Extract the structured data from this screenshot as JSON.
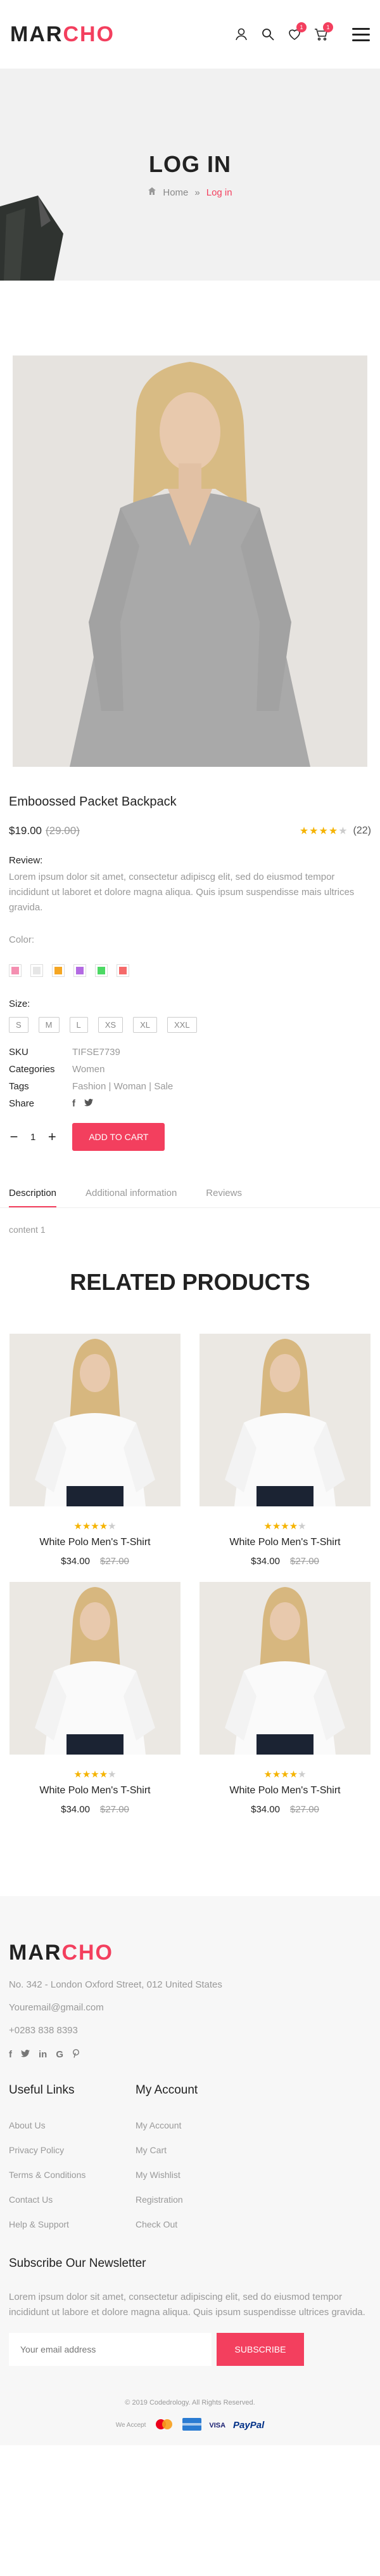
{
  "header": {
    "logo_dark": "MAR",
    "logo_red": "CHO",
    "wishlist_count": "1",
    "cart_count": "1"
  },
  "banner": {
    "title": "LOG IN",
    "crumb_home": "Home",
    "crumb_sep": "»",
    "crumb_active": "Log in"
  },
  "product": {
    "title": "Emboossed Packet Backpack",
    "price": "$19.00",
    "old_price": "(29.00)",
    "rating": 4,
    "rating_max": 5,
    "reviews": "(22)",
    "review_label": "Review:",
    "review_text": "Lorem ipsum dolor sit amet, consectetur adipiscg elit, sed do eiusmod tempor incididunt ut laboret et dolore magna aliqua. Quis ipsum suspendisse mais ultrices gravida.",
    "color_label": "Color:",
    "colors": [
      "#f48fb1",
      "#e6e6e6",
      "#f5a623",
      "#b36ae2",
      "#4cd964",
      "#f56a6a"
    ],
    "size_label": "Size:",
    "sizes": [
      "S",
      "M",
      "L",
      "XS",
      "XL",
      "XXL"
    ],
    "sku_label": "SKU",
    "sku_value": "TIFSE7739",
    "cat_label": "Categories",
    "cat_value": "Women",
    "tags_label": "Tags",
    "tags_value": "Fashion | Woman | Sale",
    "share_label": "Share",
    "qty_minus": "−",
    "qty_value": "1",
    "qty_plus": "+",
    "add_to_cart": "ADD TO CART"
  },
  "tabs": {
    "description": "Description",
    "additional": "Additional information",
    "reviews": "Reviews",
    "content": "content 1"
  },
  "related": {
    "title": "RELATED PRODUCTS",
    "items": [
      {
        "name": "White Polo Men's T-Shirt",
        "price": "$34.00",
        "old": "$27.00",
        "rating": 4
      },
      {
        "name": "White Polo Men's T-Shirt",
        "price": "$34.00",
        "old": "$27.00",
        "rating": 4
      },
      {
        "name": "White Polo Men's T-Shirt",
        "price": "$34.00",
        "old": "$27.00",
        "rating": 4
      },
      {
        "name": "White Polo Men's T-Shirt",
        "price": "$34.00",
        "old": "$27.00",
        "rating": 4
      }
    ]
  },
  "footer": {
    "logo_dark": "MAR",
    "logo_red": "CHO",
    "address": "No. 342 - London Oxford Street, 012 United States",
    "email": "Youremail@gmail.com",
    "phone": "+0283 838 8393",
    "useful_title": "Useful Links",
    "useful": [
      "About Us",
      "Privacy Policy",
      "Terms & Conditions",
      "Contact Us",
      "Help & Support"
    ],
    "account_title": "My Account",
    "account": [
      "My Account",
      "My Cart",
      "My Wishlist",
      "Registration",
      "Check Out"
    ],
    "newsletter_title": "Subscribe Our Newsletter",
    "newsletter_text": "Lorem ipsum dolor sit amet, consectetur adipiscing elit, sed do eiusmod tempor incididunt ut labore et dolore magna aliqua. Quis ipsum suspendisse ultrices gravida.",
    "email_placeholder": "Your email address",
    "subscribe": "SUBSCRIBE",
    "copyright": "© 2019 Codedrology. All Rights Reserved.",
    "we_accept": "We Accept",
    "pay_visa": "VISA",
    "pay_paypal": "PayPal"
  }
}
